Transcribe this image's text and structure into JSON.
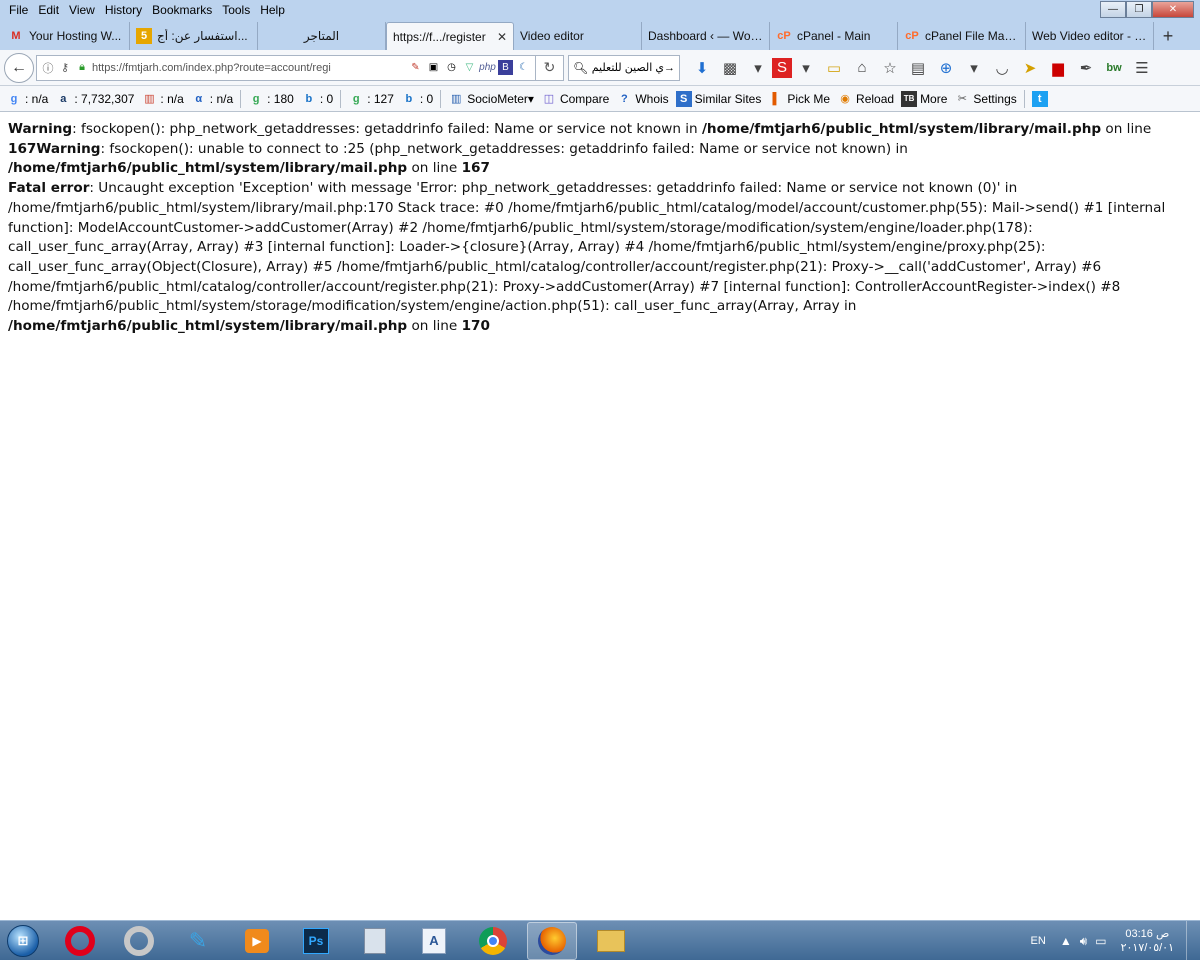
{
  "menu": [
    "File",
    "Edit",
    "View",
    "History",
    "Bookmarks",
    "Tools",
    "Help"
  ],
  "window_controls": {
    "minimize": "—",
    "maximize": "❐",
    "close": "✕"
  },
  "tabs": [
    {
      "title": "Your Hosting W...",
      "icon": "gmail-icon",
      "icon_glyph": "M",
      "icon_color": "#d93025"
    },
    {
      "title": "استفسار عن: أج...",
      "icon": "number-5-icon",
      "icon_glyph": "5",
      "icon_color": "#e6a600"
    },
    {
      "title": "المتاجر",
      "icon": "blank-page-icon",
      "icon_glyph": "",
      "icon_color": "#999999"
    },
    {
      "title": "https://f.../register",
      "icon": "",
      "icon_glyph": "",
      "icon_color": "#999999",
      "active": true,
      "close": "✕"
    },
    {
      "title": "Video editor",
      "icon": "",
      "icon_glyph": "",
      "icon_color": "#999999"
    },
    {
      "title": "Dashboard ‹ — Wor...",
      "icon": "",
      "icon_glyph": "",
      "icon_color": "#999999"
    },
    {
      "title": "cPanel - Main",
      "icon": "cpanel-icon",
      "icon_glyph": "cP",
      "icon_color": "#ff6c2c"
    },
    {
      "title": "cPanel File Man...",
      "icon": "cpanel-icon",
      "icon_glyph": "cP",
      "icon_color": "#ff6c2c"
    },
    {
      "title": "Web Video editor - J...",
      "icon": "",
      "icon_glyph": "",
      "icon_color": "#999999"
    }
  ],
  "newtab_label": "+",
  "nav": {
    "url": "https://fmtjarh.com/index.php?route=account/regi",
    "search_text": "ي الصين للتعليم"
  },
  "addonbar": [
    {
      "icon": "google-pagerank-icon",
      "text": ": n/a"
    },
    {
      "icon": "alexa-icon",
      "text": ": 7,732,307"
    },
    {
      "icon": "stats-icon",
      "text": ": n/a"
    },
    {
      "icon": "alpha-icon",
      "text": ": n/a"
    },
    {
      "icon": "google-index-icon",
      "text": ": 180"
    },
    {
      "icon": "bing-index-icon",
      "text": ": 0"
    },
    {
      "icon": "google-links-icon",
      "text": ": 127"
    },
    {
      "icon": "bing-links-icon",
      "text": ": 0"
    },
    {
      "icon": "sociometer-icon",
      "text": "SocioMeter▾"
    },
    {
      "icon": "compare-icon",
      "text": "Compare"
    },
    {
      "icon": "whois-icon",
      "text": "Whois"
    },
    {
      "icon": "similar-sites-icon",
      "text": "Similar Sites"
    },
    {
      "icon": "pickme-icon",
      "text": "Pick Me"
    },
    {
      "icon": "reload-icon",
      "text": "Reload"
    },
    {
      "icon": "more-icon",
      "text": "More"
    },
    {
      "icon": "settings-icon",
      "text": "Settings"
    }
  ],
  "error": {
    "w1_label": "Warning",
    "w1_text": ": fsockopen(): php_network_getaddresses: getaddrinfo failed: Name or service not known in ",
    "w1_file": "/home/fmtjarh6/public_html/system/library/mail.php",
    "w1_online": " on line ",
    "w1_line_w2_label": "167Warning",
    "w2_text": ": fsockopen(): unable to connect to :25 (php_network_getaddresses: getaddrinfo failed: Name or service not known) in ",
    "w2_file": "/home/fmtjarh6/public_html/system/library/mail.php",
    "w2_online": " on line ",
    "w2_line": "167",
    "f_label": "Fatal error",
    "f_text": ": Uncaught exception 'Exception' with message 'Error: php_network_getaddresses: getaddrinfo failed: Name or service not known (0)' in /home/fmtjarh6/public_html/system/library/mail.php:170 Stack trace: #0 /home/fmtjarh6/public_html/catalog/model/account/customer.php(55): Mail->send() #1 [internal function]: ModelAccountCustomer->addCustomer(Array) #2 /home/fmtjarh6/public_html/system/storage/modification/system/engine/loader.php(178): call_user_func_array(Array, Array) #3 [internal function]: Loader->{closure}(Array, Array) #4 /home/fmtjarh6/public_html/system/engine/proxy.php(25): call_user_func_array(Object(Closure), Array) #5 /home/fmtjarh6/public_html/catalog/controller/account/register.php(21): Proxy->__call('addCustomer', Array) #6 /home/fmtjarh6/public_html/catalog/controller/account/register.php(21): Proxy->addCustomer(Array) #7 [internal function]: ControllerAccountRegister->index() #8 /home/fmtjarh6/public_html/system/storage/modification/system/engine/action.php(51): call_user_func_array(Array, Array in ",
    "f_file": "/home/fmtjarh6/public_html/system/library/mail.php",
    "f_online": " on line ",
    "f_line": "170"
  },
  "taskbar": {
    "apps": [
      {
        "name": "opera-icon",
        "glyph": "O",
        "color": "#e0001b"
      },
      {
        "name": "opera-gx-icon",
        "glyph": "O",
        "color": "#c8c8c8"
      },
      {
        "name": "paint-icon",
        "glyph": "✎",
        "color": "#3aa3e3"
      },
      {
        "name": "media-player-icon",
        "glyph": "▶",
        "color": "#f08a1c"
      },
      {
        "name": "photoshop-icon",
        "glyph": "Ps",
        "color": "#0c2b4a"
      },
      {
        "name": "calculator-icon",
        "glyph": "▦",
        "color": "#7f8ea3"
      },
      {
        "name": "text-editor-icon",
        "glyph": "A",
        "color": "#d7e3f2"
      },
      {
        "name": "chrome-icon",
        "glyph": "◉",
        "color": "#3c9a4b"
      },
      {
        "name": "firefox-icon",
        "glyph": "◐",
        "color": "#e66000",
        "active": true
      },
      {
        "name": "explorer-icon",
        "glyph": "▤",
        "color": "#e8c35a"
      }
    ],
    "lang": "EN",
    "time": "03:16 ص",
    "date": "٢٠١٧/٠٥/٠١"
  }
}
